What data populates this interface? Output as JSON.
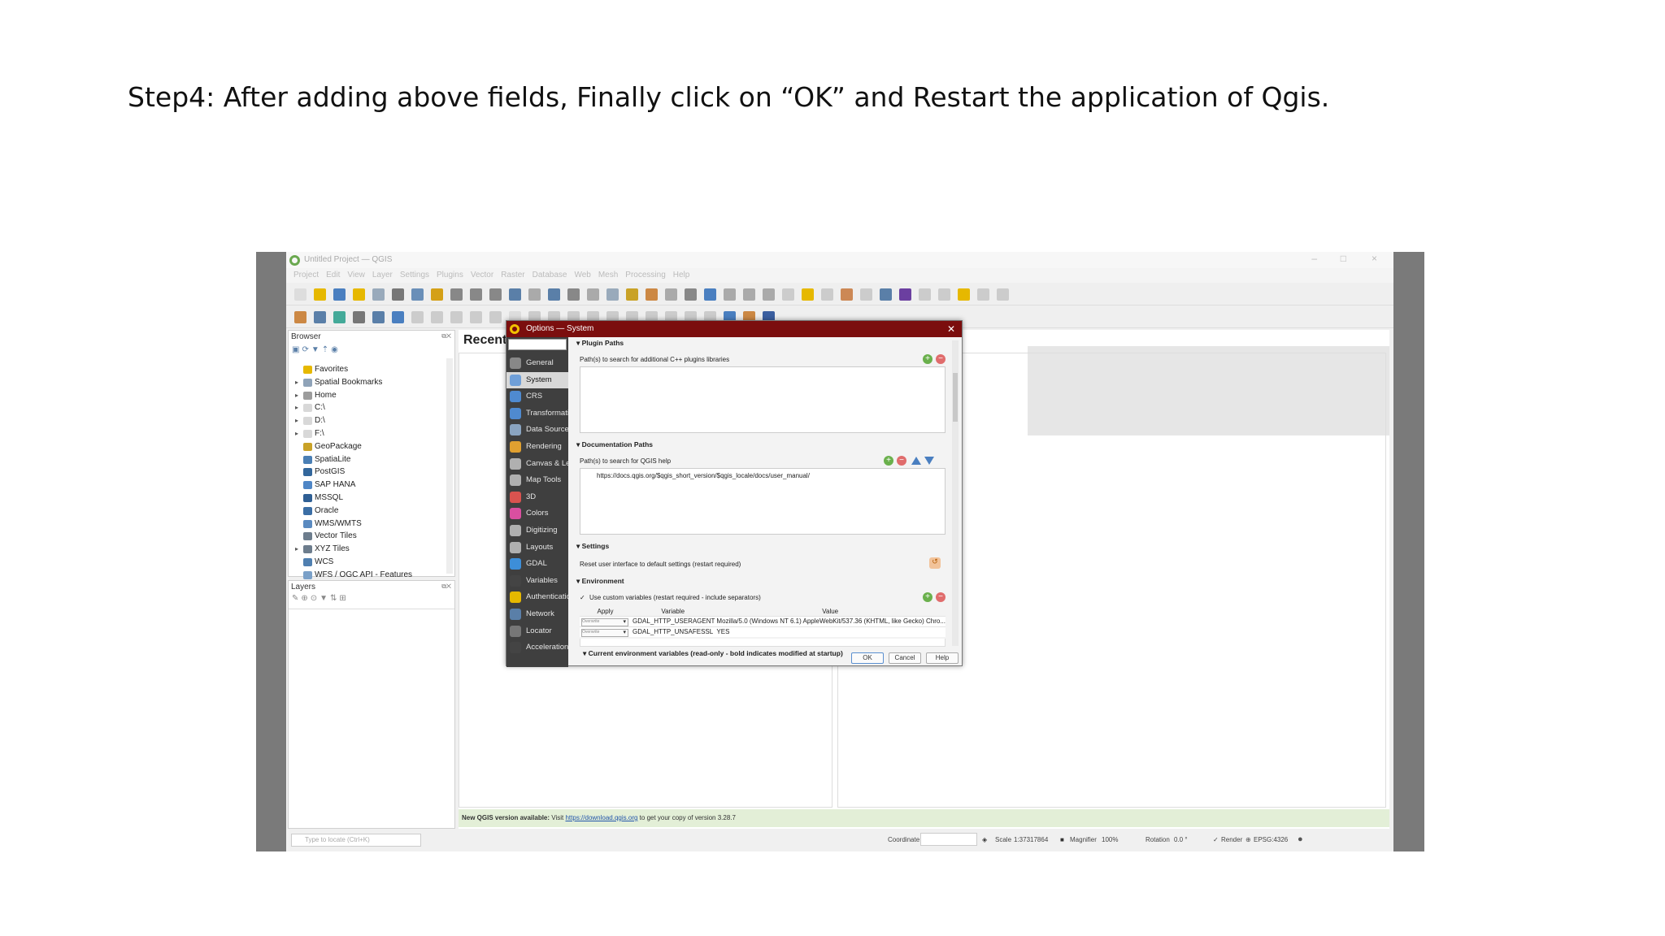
{
  "caption": "Step4: After adding above fields, Finally click on “OK” and Restart the application of Qgis.",
  "qgis": {
    "title": "Untitled Project — QGIS",
    "menu": [
      "Project",
      "Edit",
      "View",
      "Layer",
      "Settings",
      "Plugins",
      "Vector",
      "Raster",
      "Database",
      "Web",
      "Mesh",
      "Processing",
      "Help"
    ],
    "browser_title": "Browser",
    "browser_items": [
      {
        "label": "Favorites",
        "arrow": "",
        "color": "#e6b800"
      },
      {
        "label": "Spatial Bookmarks",
        "arrow": "▸",
        "color": "#8fa3b8"
      },
      {
        "label": "Home",
        "arrow": "▸",
        "color": "#9c9c9c"
      },
      {
        "label": "C:\\",
        "arrow": "▸",
        "color": "#d8d8d8"
      },
      {
        "label": "D:\\",
        "arrow": "▸",
        "color": "#d8d8d8"
      },
      {
        "label": "F:\\",
        "arrow": "▸",
        "color": "#d8d8d8"
      },
      {
        "label": "GeoPackage",
        "arrow": "",
        "color": "#c9a227"
      },
      {
        "label": "SpatiaLite",
        "arrow": "",
        "color": "#4a7fb5"
      },
      {
        "label": "PostGIS",
        "arrow": "",
        "color": "#33679c"
      },
      {
        "label": "SAP HANA",
        "arrow": "",
        "color": "#4f86c6"
      },
      {
        "label": "MSSQL",
        "arrow": "",
        "color": "#2f5f94"
      },
      {
        "label": "Oracle",
        "arrow": "",
        "color": "#3b6ea5"
      },
      {
        "label": "WMS/WMTS",
        "arrow": "",
        "color": "#5a8ac0"
      },
      {
        "label": "Vector Tiles",
        "arrow": "",
        "color": "#6d7d8d"
      },
      {
        "label": "XYZ Tiles",
        "arrow": "▸",
        "color": "#6d7d8d"
      },
      {
        "label": "WCS",
        "arrow": "",
        "color": "#4f7fb0"
      },
      {
        "label": "WFS / OGC API - Features",
        "arrow": "",
        "color": "#7aa0c8"
      }
    ],
    "layers_title": "Layers",
    "recent_heading": "Recent Proje",
    "new_version_bold": "New QGIS version available:",
    "new_version_visit": "Visit",
    "new_version_link": "https://download.qgis.org",
    "new_version_rest": "to get your copy of version 3.28.7",
    "locator_placeholder": "Type to locate (Ctrl+K)",
    "status": {
      "coordinate_label": "Coordinate",
      "scale_label": "Scale",
      "scale_value": "1:37317864",
      "magnifier_label": "Magnifier",
      "magnifier_value": "100%",
      "rotation_label": "Rotation",
      "rotation_value": "0.0 °",
      "render_label": "Render",
      "crs": "EPSG:4326"
    }
  },
  "options_dialog": {
    "title": "Options — System",
    "sidebar": [
      "General",
      "System",
      "CRS",
      "Transformations",
      "Data Sources",
      "Rendering",
      "Canvas & Legend",
      "Map Tools",
      "3D",
      "Colors",
      "Digitizing",
      "Layouts",
      "GDAL",
      "Variables",
      "Authentication",
      "Network",
      "Locator",
      "Acceleration"
    ],
    "sidebar_colors": [
      "#888888",
      "#6f9fd8",
      "#4f8ad0",
      "#4f8ad0",
      "#8aa4c0",
      "#e0a030",
      "#b0b0b0",
      "#b0b0b0",
      "#d9534f",
      "#d94fa0",
      "#b0b0b0",
      "#b0b0b0",
      "#3d8ed8",
      "#444444",
      "#e6b800",
      "#5a7fa8",
      "#777777",
      "#444444"
    ],
    "plugin_paths": {
      "section": "Plugin Paths",
      "label": "Path(s) to search for additional C++ plugins libraries"
    },
    "documentation_paths": {
      "section": "Documentation Paths",
      "label": "Path(s) to search for QGIS help",
      "value": "https://docs.qgis.org/$qgis_short_version/$qgis_locale/docs/user_manual/"
    },
    "settings": {
      "section": "Settings",
      "label": "Reset user interface to default settings (restart required)"
    },
    "environment": {
      "section": "Environment",
      "checkbox_label": "Use custom variables (restart required - include separators)",
      "headers": [
        "Apply",
        "Variable",
        "Value"
      ],
      "rows": [
        {
          "apply": "Overwrite",
          "variable": "GDAL_HTTP_USERAGENT",
          "value": "Mozilla/5.0 (Windows NT 6.1) AppleWebKit/537.36 (KHTML, like Gecko) Chro..."
        },
        {
          "apply": "Overwrite",
          "variable": "GDAL_HTTP_UNSAFESSL",
          "value": "YES"
        }
      ],
      "current_section": "Current environment variables (read-only - bold indicates modified at startup)"
    },
    "buttons": {
      "ok": "OK",
      "cancel": "Cancel",
      "help": "Help"
    }
  }
}
